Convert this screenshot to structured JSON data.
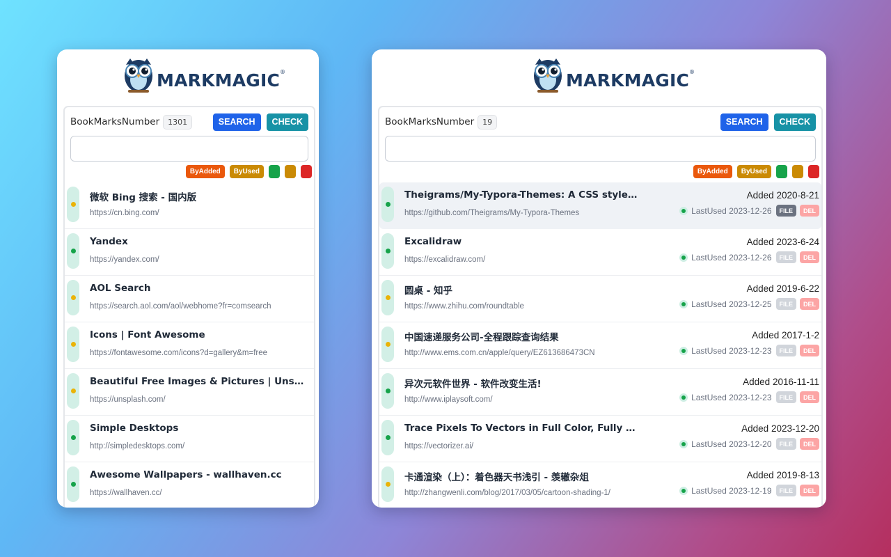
{
  "colors": {
    "green": "#16a34a",
    "yellow": "#eab308",
    "red": "#dc2626",
    "search_btn": "#1f63e9",
    "check_btn": "#1792a6",
    "by_added": "#ea580c",
    "by_used": "#ca8a04"
  },
  "left": {
    "logo_text": "MARKMAGIC",
    "logo_mark": "®",
    "count_label": "BookMarksNumber",
    "count": "1301",
    "search_label": "SEARCH",
    "check_label": "CHECK",
    "search_value": "",
    "by_added": "ByAdded",
    "by_used": "ByUsed",
    "items": [
      {
        "title": "微软 Bing 搜索 - 国内版",
        "url": "https://cn.bing.com/",
        "status": "yellow"
      },
      {
        "title": "Yandex",
        "url": "https://yandex.com/",
        "status": "green"
      },
      {
        "title": "AOL Search",
        "url": "https://search.aol.com/aol/webhome?fr=comsearch",
        "status": "yellow"
      },
      {
        "title": "Icons | Font Awesome",
        "url": "https://fontawesome.com/icons?d=gallery&m=free",
        "status": "yellow"
      },
      {
        "title": "Beautiful Free Images & Pictures | Unsplash",
        "url": "https://unsplash.com/",
        "status": "yellow"
      },
      {
        "title": "Simple Desktops",
        "url": "http://simpledesktops.com/",
        "status": "green"
      },
      {
        "title": "Awesome Wallpapers - wallhaven.cc",
        "url": "https://wallhaven.cc/",
        "status": "green"
      }
    ]
  },
  "right": {
    "logo_text": "MARKMAGIC",
    "logo_mark": "®",
    "count_label": "BookMarksNumber",
    "count": "19",
    "search_label": "SEARCH",
    "check_label": "CHECK",
    "search_value": "",
    "by_added": "ByAdded",
    "by_used": "ByUsed",
    "file_label": "FILE",
    "del_label": "DEL",
    "items": [
      {
        "title": "Theigrams/My-Typora-Themes: A CSS style for Typora",
        "url": "https://github.com/Theigrams/My-Typora-Themes",
        "added": "Added 2020-8-21",
        "last_used": "LastUsed 2023-12-26",
        "status": "green"
      },
      {
        "title": "Excalidraw",
        "url": "https://excalidraw.com/",
        "added": "Added 2023-6-24",
        "last_used": "LastUsed 2023-12-26",
        "status": "green"
      },
      {
        "title": "圆桌 - 知乎",
        "url": "https://www.zhihu.com/roundtable",
        "added": "Added 2019-6-22",
        "last_used": "LastUsed 2023-12-25",
        "status": "yellow"
      },
      {
        "title": "中国速递服务公司-全程跟踪查询结果",
        "url": "http://www.ems.com.cn/apple/query/EZ613686473CN",
        "added": "Added 2017-1-2",
        "last_used": "LastUsed 2023-12-23",
        "status": "yellow"
      },
      {
        "title": "异次元软件世界 - 软件改变生活!",
        "url": "http://www.iplaysoft.com/",
        "added": "Added 2016-11-11",
        "last_used": "LastUsed 2023-12-23",
        "status": "green"
      },
      {
        "title": "Trace Pixels To Vectors in Full Color, Fully Automatically",
        "url": "https://vectorizer.ai/",
        "added": "Added 2023-12-20",
        "last_used": "LastUsed 2023-12-20",
        "status": "green"
      },
      {
        "title": "卡通渲染（上）：着色器天书浅引 - 羡辙杂俎",
        "url": "http://zhangwenli.com/blog/2017/03/05/cartoon-shading-1/",
        "added": "Added 2019-8-13",
        "last_used": "LastUsed 2023-12-19",
        "status": "yellow"
      }
    ]
  }
}
